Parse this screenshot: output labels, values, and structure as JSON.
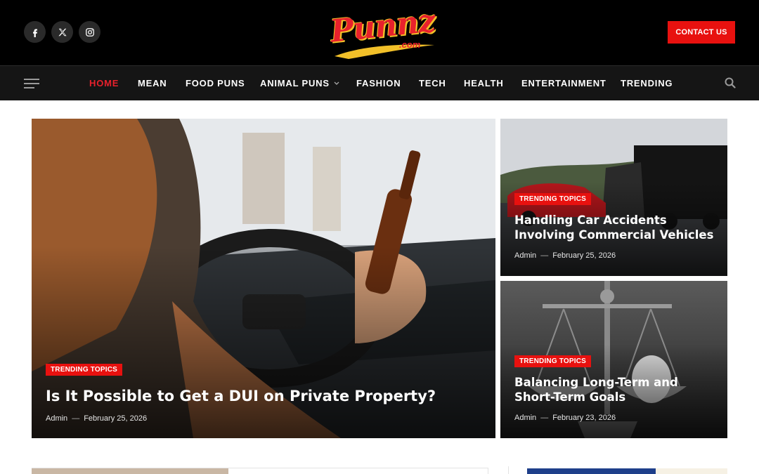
{
  "header": {
    "logo_text": "Punnz",
    "logo_suffix": ".com",
    "contact_label": "CONTACT US",
    "socials": [
      "facebook-icon",
      "x-icon",
      "instagram-icon"
    ]
  },
  "nav": {
    "items": [
      {
        "label": "HOME",
        "active": true
      },
      {
        "label": "MEAN"
      },
      {
        "label": "FOOD PUNS"
      },
      {
        "label": "ANIMAL PUNS",
        "dropdown": true
      },
      {
        "label": "FASHION"
      },
      {
        "label": "TECH"
      },
      {
        "label": "HEALTH"
      },
      {
        "label": "ENTERTAINMENT"
      },
      {
        "label": "TRENDING"
      }
    ]
  },
  "featured": {
    "main": {
      "tag": "TRENDING TOPICS",
      "title": "Is It Possible to Get a DUI on Private Property?",
      "author": "Admin",
      "date": "February 25, 2026"
    },
    "side": [
      {
        "tag": "TRENDING TOPICS",
        "title": "Handling Car Accidents Involving Commercial Vehicles",
        "author": "Admin",
        "date": "February 25, 2026"
      },
      {
        "tag": "TRENDING TOPICS",
        "title": "Balancing Long-Term and Short-Term Goals",
        "author": "Admin",
        "date": "February 23, 2026"
      }
    ]
  },
  "colors": {
    "accent": "#e8110f",
    "header_bg": "#000000",
    "nav_bg": "#151515"
  }
}
